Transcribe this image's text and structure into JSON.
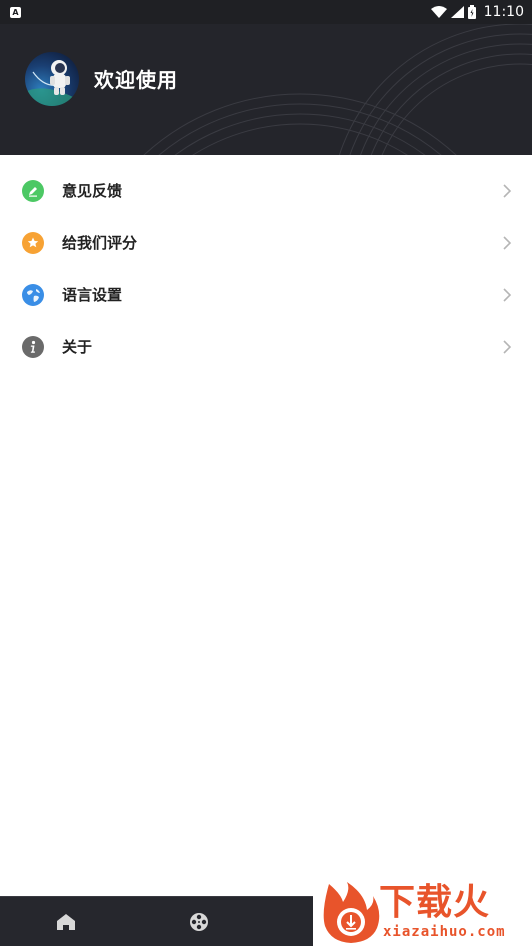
{
  "status_bar": {
    "notification_icon": "text-notification-icon",
    "time": "11:10"
  },
  "header": {
    "welcome_text": "欢迎使用",
    "avatar_icon": "astronaut-avatar"
  },
  "menu": {
    "items": [
      {
        "label": "意见反馈",
        "icon": "feedback-pencil-icon",
        "icon_color": "#4cc864"
      },
      {
        "label": "给我们评分",
        "icon": "rate-star-icon",
        "icon_color": "#f7a234"
      },
      {
        "label": "语言设置",
        "icon": "language-globe-icon",
        "icon_color": "#3a8ee6"
      },
      {
        "label": "关于",
        "icon": "about-info-icon",
        "icon_color": "#6a6a6a"
      }
    ]
  },
  "bottom_nav": {
    "items": [
      {
        "icon": "home-icon"
      },
      {
        "icon": "film-reel-icon"
      }
    ]
  },
  "watermark": {
    "text": "下载火",
    "url": "xiazaihuo.com",
    "accent": "#e8542b"
  }
}
